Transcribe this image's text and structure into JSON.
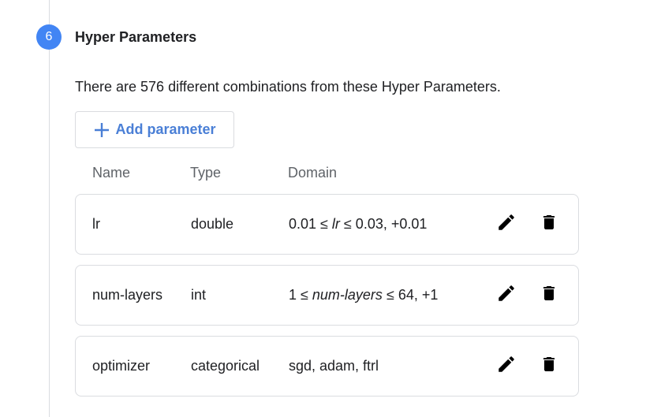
{
  "step": {
    "number": "6",
    "title": "Hyper Parameters"
  },
  "summary": "There are 576 different combinations from these Hyper Parameters.",
  "add_button_label": "Add parameter",
  "columns": {
    "name": "Name",
    "type": "Type",
    "domain": "Domain"
  },
  "rows": [
    {
      "name": "lr",
      "type": "double",
      "domain_pre": "0.01 ≤ ",
      "domain_var": "lr",
      "domain_post": " ≤ 0.03, +0.01"
    },
    {
      "name": "num-layers",
      "type": "int",
      "domain_pre": "1 ≤ ",
      "domain_var": "num-layers",
      "domain_post": " ≤ 64, +1"
    },
    {
      "name": "optimizer",
      "type": "categorical",
      "domain_pre": "sgd, adam, ftrl",
      "domain_var": "",
      "domain_post": ""
    }
  ],
  "icons": {
    "add": "plus-icon",
    "edit": "pencil-icon",
    "delete": "trash-icon"
  },
  "colors": {
    "accent": "#4285f4",
    "link": "#4a7fd6",
    "border": "#dadce0"
  }
}
